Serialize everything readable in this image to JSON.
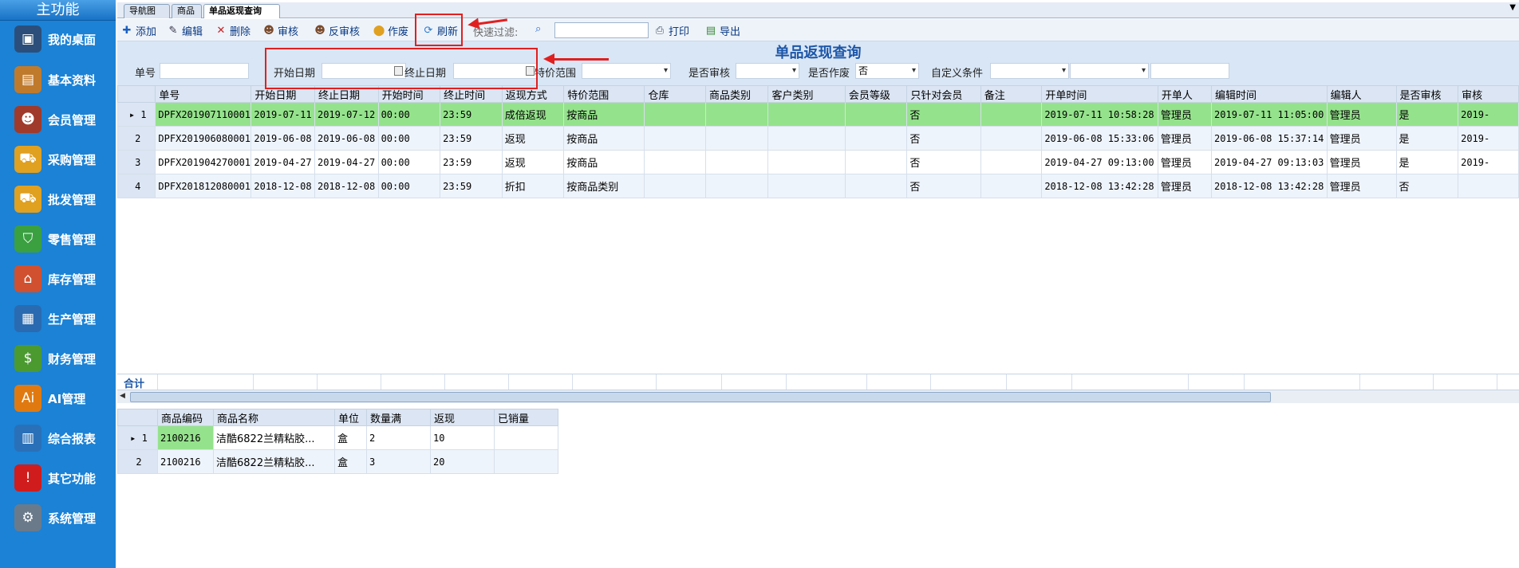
{
  "sidebar": {
    "title": "主功能",
    "items": [
      {
        "label": "我的桌面",
        "icon": "monitor-icon",
        "color": "#2b4f7a",
        "glyph": "▣"
      },
      {
        "label": "基本资料",
        "icon": "folder-icon",
        "color": "#c07a2c",
        "glyph": "▤"
      },
      {
        "label": "会员管理",
        "icon": "members-icon",
        "color": "#a03a2a",
        "glyph": "☻"
      },
      {
        "label": "采购管理",
        "icon": "truck-icon",
        "color": "#e0a020",
        "glyph": "⛟"
      },
      {
        "label": "批发管理",
        "icon": "truck-icon",
        "color": "#e0a020",
        "glyph": "⛟"
      },
      {
        "label": "零售管理",
        "icon": "cart-icon",
        "color": "#3aa040",
        "glyph": "⛉"
      },
      {
        "label": "库存管理",
        "icon": "house-icon",
        "color": "#d05030",
        "glyph": "⌂"
      },
      {
        "label": "生产管理",
        "icon": "printer-icon",
        "color": "#2a6ab0",
        "glyph": "▦"
      },
      {
        "label": "财务管理",
        "icon": "money-icon",
        "color": "#4a9a30",
        "glyph": "$"
      },
      {
        "label": "AI管理",
        "icon": "ai-icon",
        "color": "#e07a10",
        "glyph": "Ai"
      },
      {
        "label": "综合报表",
        "icon": "chart-icon",
        "color": "#2a70b8",
        "glyph": "▥"
      },
      {
        "label": "其它功能",
        "icon": "alert-icon",
        "color": "#d01c1c",
        "glyph": "!"
      },
      {
        "label": "系统管理",
        "icon": "gear-icon",
        "color": "#6a7a8a",
        "glyph": "⚙"
      }
    ]
  },
  "tabs": [
    "导航图",
    "商品",
    "单品返现查询"
  ],
  "toolbar": {
    "add": "添加",
    "edit": "编辑",
    "delete": "删除",
    "audit": "审核",
    "unaudit": "反审核",
    "void": "作废",
    "refresh": "刷新",
    "filter_label": "快速过滤:",
    "print": "打印",
    "export": "导出"
  },
  "query": {
    "title": "单品返现查询",
    "bill_no_label": "单号",
    "start_date_label": "开始日期",
    "end_date_label": "终止日期",
    "price_range_label": "特价范围",
    "audited_label": "是否审核",
    "voided_label": "是否作废",
    "voided_value": "否",
    "custom_label": "自定义条件"
  },
  "grid": {
    "headers": [
      "单号",
      "开始日期",
      "终止日期",
      "开始时间",
      "终止时间",
      "返现方式",
      "特价范围",
      "仓库",
      "商品类别",
      "客户类别",
      "会员等级",
      "只针对会员",
      "备注",
      "开单时间",
      "开单人",
      "编辑时间",
      "编辑人",
      "是否审核",
      "审核"
    ],
    "rows": [
      [
        "DPFX201907110001",
        "2019-07-11",
        "2019-07-12",
        "00:00",
        "23:59",
        "成倍返现",
        "按商品",
        "",
        "",
        "",
        "",
        "否",
        "",
        "2019-07-11 10:58:28",
        "管理员",
        "2019-07-11 11:05:00",
        "管理员",
        "是",
        "2019-"
      ],
      [
        "DPFX201906080001",
        "2019-06-08",
        "2019-06-08",
        "00:00",
        "23:59",
        "返现",
        "按商品",
        "",
        "",
        "",
        "",
        "否",
        "",
        "2019-06-08 15:33:06",
        "管理员",
        "2019-06-08 15:37:14",
        "管理员",
        "是",
        "2019-"
      ],
      [
        "DPFX201904270001",
        "2019-04-27",
        "2019-04-27",
        "00:00",
        "23:59",
        "返现",
        "按商品",
        "",
        "",
        "",
        "",
        "否",
        "",
        "2019-04-27 09:13:00",
        "管理员",
        "2019-04-27 09:13:03",
        "管理员",
        "是",
        "2019-"
      ],
      [
        "DPFX201812080001",
        "2018-12-08",
        "2018-12-08",
        "00:00",
        "23:59",
        "折扣",
        "按商品类别",
        "",
        "",
        "",
        "",
        "否",
        "",
        "2018-12-08 13:42:28",
        "管理员",
        "2018-12-08 13:42:28",
        "管理员",
        "否",
        ""
      ]
    ],
    "sum_label": "合计"
  },
  "detail": {
    "headers": [
      "商品编码",
      "商品名称",
      "单位",
      "数量满",
      "返现",
      "已销量"
    ],
    "rows": [
      [
        "2100216",
        "洁酷6822兰精粘胶...",
        "盒",
        "2",
        "10",
        ""
      ],
      [
        "2100216",
        "洁酷6822兰精粘胶...",
        "盒",
        "3",
        "20",
        ""
      ]
    ]
  }
}
